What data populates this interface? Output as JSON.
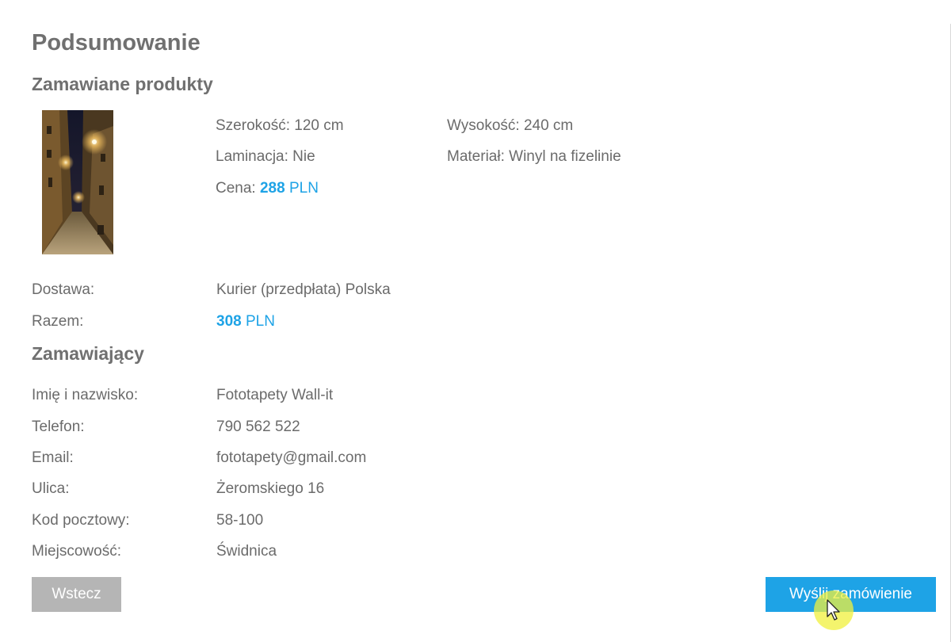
{
  "page_title": "Podsumowanie",
  "products_heading": "Zamawiane produkty",
  "product": {
    "image_icon": "wallpaper-thumbnail-night-alley",
    "width_text": "Szerokość: 120 cm",
    "height_text": "Wysokość: 240 cm",
    "lamination_text": "Laminacja: Nie",
    "material_text": "Materiał: Winyl na fizelinie",
    "price_label": "Cena:",
    "price_value": "288",
    "price_currency": "PLN"
  },
  "delivery": {
    "label": "Dostawa:",
    "value": "Kurier (przedpłata) Polska"
  },
  "total": {
    "label": "Razem:",
    "value": "308",
    "currency": "PLN"
  },
  "customer_heading": "Zamawiający",
  "customer": {
    "name_label": "Imię i nazwisko:",
    "name_value": "Fototapety Wall-it",
    "phone_label": "Telefon:",
    "phone_value": "790 562 522",
    "email_label": "Email:",
    "email_value": "fototapety@gmail.com",
    "street_label": "Ulica:",
    "street_value": "Żeromskiego 16",
    "postal_label": "Kod pocztowy:",
    "postal_value": "58-100",
    "city_label": "Miejscowość:",
    "city_value": "Świdnica"
  },
  "buttons": {
    "back_label": "Wstecz",
    "send_label": "Wyślij zamówienie"
  },
  "colors": {
    "accent": "#1ea3e6",
    "back_button": "#b5b5b5",
    "text": "#6b6b6b",
    "heading": "#707070"
  }
}
